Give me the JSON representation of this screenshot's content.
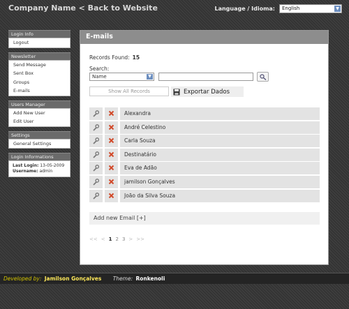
{
  "header": {
    "brand": "Company Name",
    "back_link": "< Back to Website",
    "lang_label": "Language / Idioma:",
    "lang_value": "English"
  },
  "sidebar": {
    "login_info": {
      "title": "Login Info",
      "items": [
        "Logout"
      ]
    },
    "newsletter": {
      "title": "Newsletter",
      "items": [
        "Send Message",
        "Sent Box",
        "Groups",
        "E-mails"
      ]
    },
    "users_manager": {
      "title": "Users Manager",
      "items": [
        "Add New User",
        "Edit User"
      ]
    },
    "settings": {
      "title": "Settings",
      "items": [
        "General Settings"
      ]
    },
    "login_informations": {
      "title": "Login Informations",
      "last_login_label": "Last Login:",
      "last_login_value": "13-05-2009",
      "username_label": "Username:",
      "username_value": "admin"
    }
  },
  "main": {
    "title": "E-mails",
    "records_label": "Records Found:",
    "records_count": "15",
    "search_label": "Search:",
    "search_field": "Name",
    "search_value": "",
    "show_all": "Show All Records",
    "export": "Exportar Dados",
    "rows": [
      "Alexandra",
      "André Celestino",
      "Carla Souza",
      "Destinatário",
      "Eva de Adão",
      "jamilson Gonçalves",
      "João da Silva Souza"
    ],
    "add_new": "Add new Email [+]",
    "pager": {
      "first": "<<",
      "prev": "<",
      "pages": [
        "1",
        "2",
        "3"
      ],
      "next": ">",
      "last": ">>"
    }
  },
  "footer": {
    "developed_label": "Developed by:",
    "developer": "Jamilson Gonçalves",
    "theme_label": "Theme:",
    "theme": "Ronkenoli"
  },
  "colors": {
    "panel_header": "#8d8d8d",
    "row_bg": "#e3e3e3",
    "footer_text": "#ffe95a"
  }
}
